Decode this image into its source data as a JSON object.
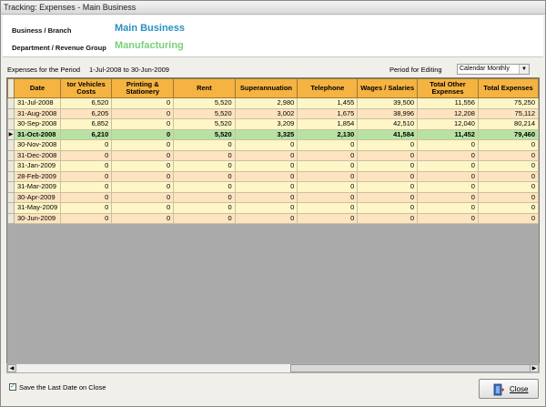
{
  "window": {
    "title": "Tracking: Expenses - Main Business"
  },
  "header": {
    "business_label": "Business / Branch",
    "business_value": "Main Business",
    "business_color": "#2a8fc4",
    "department_label": "Department / Revenue Group",
    "department_value": "Manufacturing",
    "department_color": "#7ad07a"
  },
  "period": {
    "label": "Expenses for the Period",
    "range": "1-Jul-2008 to 30-Jun-2009",
    "editing_label": "Period for Editing",
    "editing_value": "Calendar Monthly"
  },
  "grid": {
    "columns": [
      "Date",
      "tor Vehicles\nCosts",
      "Printing &\nStationery",
      "Rent",
      "Superannuation",
      "Telephone",
      "Wages / Salaries",
      "Total Other\nExpenses",
      "Total Expenses"
    ],
    "selected_row": 3,
    "rows": [
      [
        "31-Jul-2008",
        "6,520",
        "0",
        "5,520",
        "2,980",
        "1,455",
        "39,500",
        "11,556",
        "75,250"
      ],
      [
        "31-Aug-2008",
        "6,205",
        "0",
        "5,520",
        "3,002",
        "1,675",
        "38,996",
        "12,208",
        "75,112"
      ],
      [
        "30-Sep-2008",
        "6,852",
        "0",
        "5,520",
        "3,209",
        "1,854",
        "42,510",
        "12,040",
        "80,214"
      ],
      [
        "31-Oct-2008",
        "6,210",
        "0",
        "5,520",
        "3,325",
        "2,130",
        "41,584",
        "11,452",
        "79,460"
      ],
      [
        "30-Nov-2008",
        "0",
        "0",
        "0",
        "0",
        "0",
        "0",
        "0",
        "0"
      ],
      [
        "31-Dec-2008",
        "0",
        "0",
        "0",
        "0",
        "0",
        "0",
        "0",
        "0"
      ],
      [
        "31-Jan-2009",
        "0",
        "0",
        "0",
        "0",
        "0",
        "0",
        "0",
        "0"
      ],
      [
        "28-Feb-2009",
        "0",
        "0",
        "0",
        "0",
        "0",
        "0",
        "0",
        "0"
      ],
      [
        "31-Mar-2009",
        "0",
        "0",
        "0",
        "0",
        "0",
        "0",
        "0",
        "0"
      ],
      [
        "30-Apr-2009",
        "0",
        "0",
        "0",
        "0",
        "0",
        "0",
        "0",
        "0"
      ],
      [
        "31-May-2009",
        "0",
        "0",
        "0",
        "0",
        "0",
        "0",
        "0",
        "0"
      ],
      [
        "30-Jun-2009",
        "0",
        "0",
        "0",
        "0",
        "0",
        "0",
        "0",
        "0"
      ]
    ]
  },
  "footer": {
    "save_checkbox_label": "Save the Last Date on Close",
    "save_checked": true,
    "close_label": "Close"
  }
}
